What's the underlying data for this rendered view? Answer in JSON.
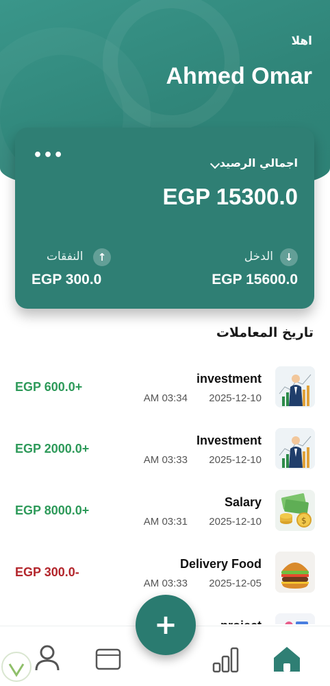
{
  "header": {
    "greeting": "اهلا",
    "user_name": "Ahmed Omar"
  },
  "balance_card": {
    "label": "اجمالي الرصيد",
    "amount": "EGP 15300.0",
    "income": {
      "label": "الدخل",
      "amount": "EGP 15600.0"
    },
    "expense": {
      "label": "النفقات",
      "amount": "EGP 300.0"
    }
  },
  "transactions_title": "تاريخ المعاملات",
  "transactions": [
    {
      "title": "investment",
      "date": "2025-12-10",
      "time": "AM 03:34",
      "amount": "EGP 600.0+",
      "type": "income",
      "icon": "investment-icon"
    },
    {
      "title": "Investment",
      "date": "2025-12-10",
      "time": "AM 03:33",
      "amount": "EGP 2000.0+",
      "type": "income",
      "icon": "investment-icon"
    },
    {
      "title": "Salary",
      "date": "2025-12-10",
      "time": "AM 03:31",
      "amount": "EGP 8000.0+",
      "type": "income",
      "icon": "money-icon"
    },
    {
      "title": "Delivery Food",
      "date": "2025-12-05",
      "time": "AM 03:33",
      "amount": "EGP 300.0-",
      "type": "expense",
      "icon": "burger-icon"
    },
    {
      "title": "project",
      "date": "",
      "time": "",
      "amount": "",
      "type": "income",
      "icon": "project-icon"
    }
  ],
  "colors": {
    "primary": "#2f7f74",
    "income": "#2e9a5a",
    "expense": "#b3262c"
  },
  "nav": [
    "profile-icon",
    "wallet-icon",
    "stats-icon",
    "home-icon"
  ]
}
